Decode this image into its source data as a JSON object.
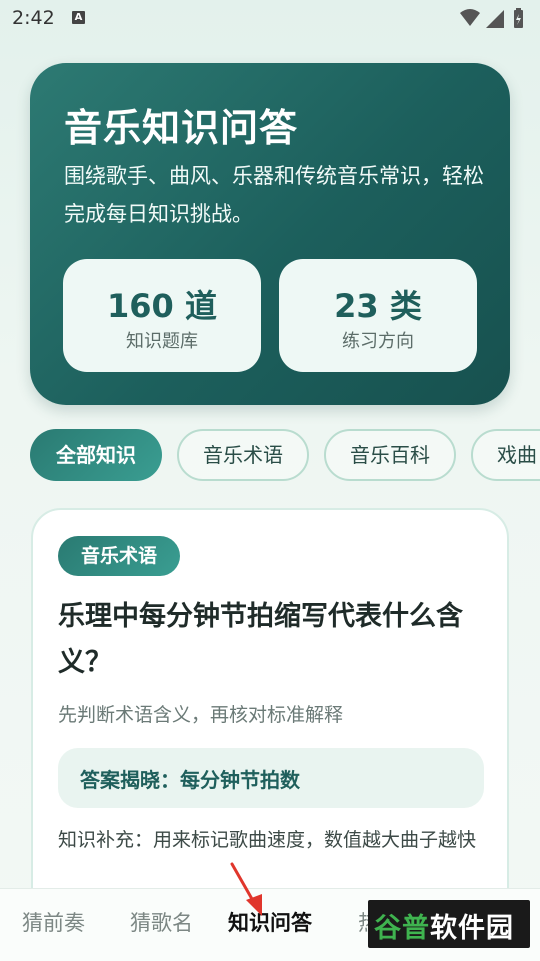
{
  "status_bar": {
    "time": "2:42",
    "badge": "A",
    "icons": [
      "wifi-icon",
      "signal-icon",
      "battery-icon"
    ]
  },
  "hero": {
    "title": "音乐知识问答",
    "description": "围绕歌手、曲风、乐器和传统音乐常识，轻松完成每日知识挑战。",
    "stats": [
      {
        "value": "160 道",
        "label": "知识题库"
      },
      {
        "value": "23 类",
        "label": "练习方向"
      }
    ]
  },
  "filters": [
    {
      "label": "全部知识",
      "active": true
    },
    {
      "label": "音乐术语",
      "active": false
    },
    {
      "label": "音乐百科",
      "active": false
    },
    {
      "label": "戏曲",
      "active": false
    }
  ],
  "question_card": {
    "tag": "音乐术语",
    "question": "乐理中每分钟节拍缩写代表什么含义？",
    "hint": "先判断术语含义，再核对标准解释",
    "answer": "答案揭晓：每分钟节拍数",
    "extra": "知识补充：用来标记歌曲速度，数值越大曲子越快"
  },
  "bottom_nav": [
    {
      "label": "猜前奏",
      "active": false
    },
    {
      "label": "猜歌名",
      "active": false
    },
    {
      "label": "知识问答",
      "active": true
    },
    {
      "label": "热",
      "active": false
    }
  ],
  "watermark": {
    "text_a": "谷普",
    "text_b": "软件园"
  },
  "colors": {
    "primary": "#1f5f5c",
    "accent": "#3a9e92",
    "background": "#e3f1ec"
  }
}
